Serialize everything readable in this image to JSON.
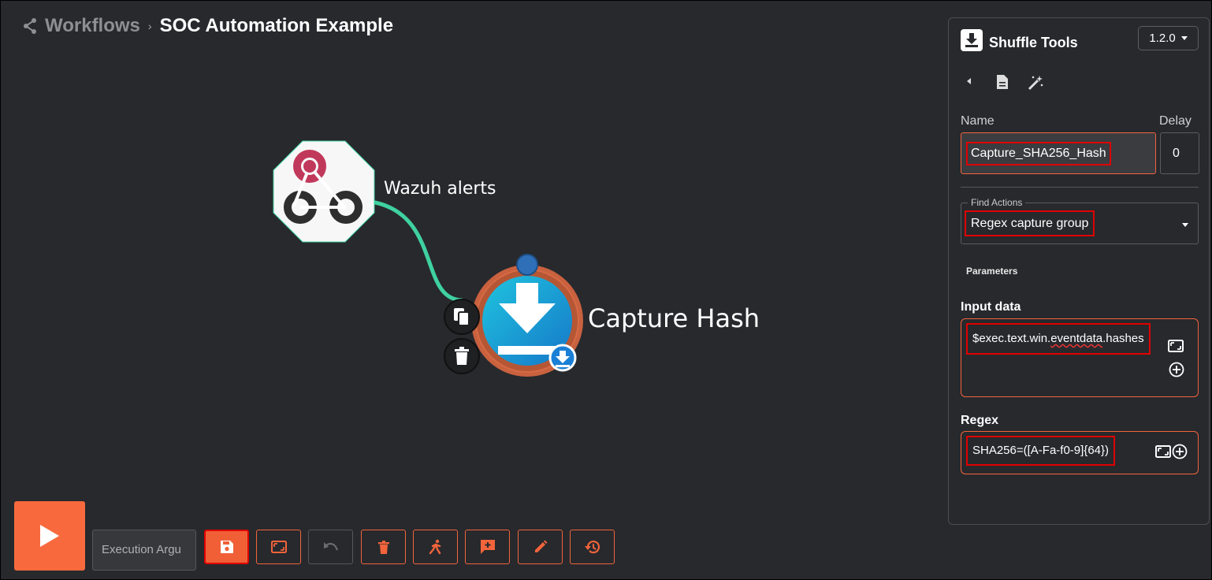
{
  "breadcrumb": {
    "root": "Workflows",
    "separator": "›",
    "current": "SOC Automation Example"
  },
  "canvas": {
    "trigger_node": {
      "label": "Wazuh alerts",
      "icon": "webhook-icon"
    },
    "action_node": {
      "label": "Capture Hash",
      "icon": "download-icon"
    },
    "edge_color": "#3fd1a0"
  },
  "panel": {
    "app_name": "Shuffle Tools",
    "version": "1.2.0",
    "name_label": "Name",
    "name_value": "Capture_SHA256_Hash",
    "delay_label": "Delay",
    "delay_value": "0",
    "find_actions_label": "Find Actions",
    "find_actions_value": "Regex capture group",
    "parameters_heading": "Parameters",
    "input_data": {
      "label": "Input data",
      "prefix": "$exec.text.win.",
      "misspelled": "eventdata",
      "suffix": ".hashes"
    },
    "regex": {
      "label": "Regex",
      "value": "SHA256=([A-Fa-f0-9]{64})"
    }
  },
  "bottom_bar": {
    "execution_args_placeholder": "Execution Argu"
  },
  "colors": {
    "accent": "#f86a3e",
    "background": "#27292d",
    "highlight": "#e00000"
  }
}
